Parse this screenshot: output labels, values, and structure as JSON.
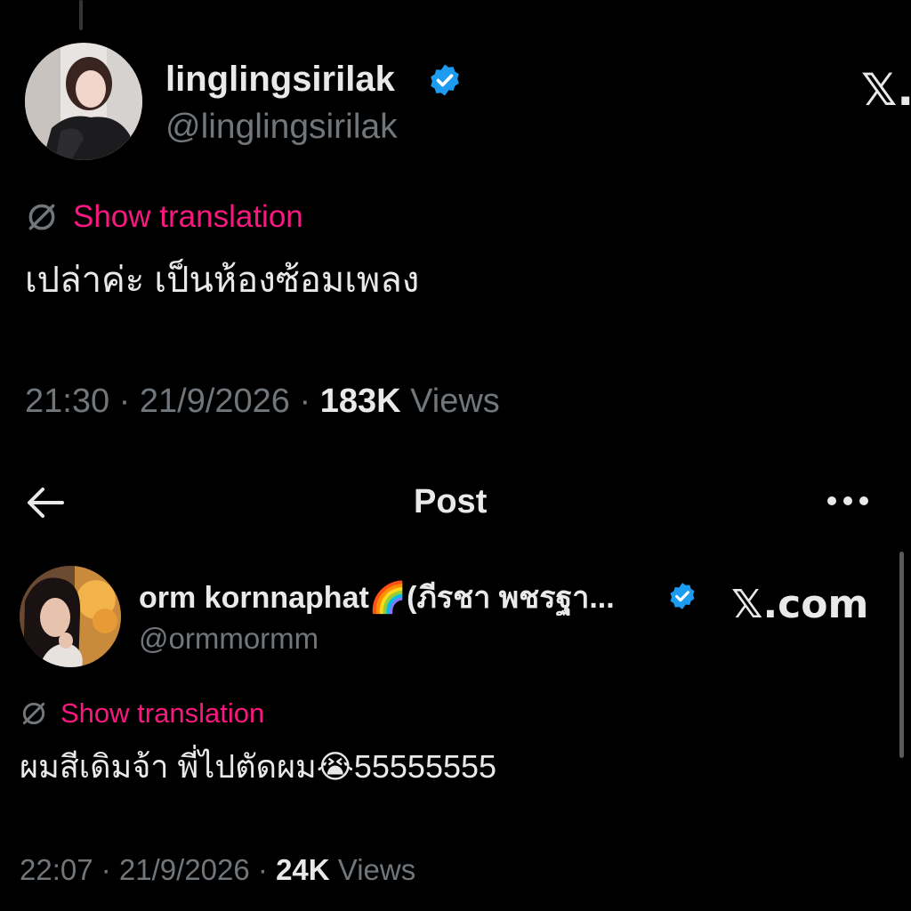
{
  "tweet1": {
    "display_name": "linglingsirilak",
    "handle": "@linglingsirilak",
    "x_logo": "𝕏.",
    "translate_label": "Show translation",
    "text": "เปล่าค่ะ เป็นห้องซ้อมเพลง",
    "time": "21:30",
    "sep1": " · ",
    "date": "21/9/2026",
    "sep2": " · ",
    "views_count": "183K",
    "views_label": " Views"
  },
  "header": {
    "title": "Post",
    "back_icon": "arrow-left-icon",
    "more_icon": "more-horizontal-icon"
  },
  "tweet2": {
    "display_name": "orm kornnaphat🌈(ภีรชา พชรฐา...",
    "handle": "@ormmormm",
    "x_logo": "𝕏.com",
    "translate_label": "Show translation",
    "text": "ผมสีเดิมจ้า พี่ไปตัดผม😭55555555",
    "time": "22:07",
    "sep1": " · ",
    "date": "21/9/2026",
    "sep2": " · ",
    "views_count": "24K",
    "views_label": " Views"
  },
  "colors": {
    "background": "#000000",
    "text": "#e7e9ea",
    "muted": "#71767b",
    "accent_pink": "#f91880",
    "verified_blue": "#1d9bf0"
  }
}
